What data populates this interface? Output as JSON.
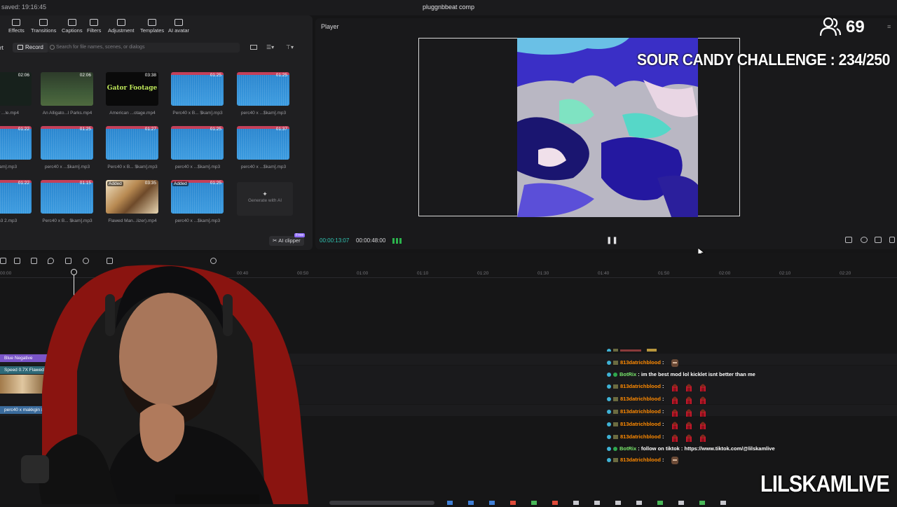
{
  "top_bar": {
    "saved_text": "saved: 19:16:45",
    "project_name": "pluggnbbeat comp"
  },
  "media_panel": {
    "tools": [
      {
        "label": "Effects",
        "icon": "effects-icon"
      },
      {
        "label": "Transitions",
        "icon": "transitions-icon"
      },
      {
        "label": "Captions",
        "icon": "captions-icon"
      },
      {
        "label": "Filters",
        "icon": "filters-icon"
      },
      {
        "label": "Adjustment",
        "icon": "adjustment-icon"
      },
      {
        "label": "Templates",
        "icon": "templates-icon"
      },
      {
        "label": "AI avatar",
        "icon": "ai-avatar-icon"
      }
    ],
    "import_partial": "rt",
    "record_label": "Record",
    "search_placeholder": "Search for file names, scenes, or dialogs",
    "items": [
      {
        "caption": "...ar ...le.mp4",
        "duration": "02:06",
        "kind": "video-dark",
        "added": ""
      },
      {
        "caption": "An Alligato...l Parks.mp4",
        "duration": "02:06",
        "kind": "video-green",
        "added": ""
      },
      {
        "caption": "American ...otage.mp4",
        "duration": "03:38",
        "kind": "gator",
        "added": "",
        "title": "Gator Footage"
      },
      {
        "caption": "Perc40 x B... $kam].mp3",
        "duration": "01:25",
        "kind": "audio",
        "added": ""
      },
      {
        "caption": "perc40 x ...$kam].mp3",
        "duration": "01:25",
        "kind": "audio",
        "added": ""
      },
      {
        "caption": "$kam].mp3",
        "duration": "01:22",
        "kind": "audio",
        "added": ""
      },
      {
        "caption": "perc40 x ...$kam].mp3",
        "duration": "01:25",
        "kind": "audio",
        "added": ""
      },
      {
        "caption": "Perc40 x B... $kam].mp3",
        "duration": "01:27",
        "kind": "audio",
        "added": ""
      },
      {
        "caption": "perc40 x ...$kam].mp3",
        "duration": "01:25",
        "kind": "audio",
        "added": ""
      },
      {
        "caption": "perc40 x ...$kam].mp3",
        "duration": "01:37",
        "kind": "audio",
        "added": ""
      },
      {
        "caption": "mp3 2.mp3",
        "duration": "01:22",
        "kind": "audio",
        "added": ""
      },
      {
        "caption": "Perc40 x B... $kam].mp3",
        "duration": "01:15",
        "kind": "audio",
        "added": ""
      },
      {
        "caption": "Flawed Man...lizer).mp4",
        "duration": "03:35",
        "kind": "video-sepia",
        "added": "Added"
      },
      {
        "caption": "perc40 x ...$kam].mp3",
        "duration": "01:25",
        "kind": "audio",
        "added": "Added"
      }
    ],
    "generate_ai_label": "Generate with AI",
    "ai_clipper_label": "AI clipper",
    "ai_clipper_badge": "Free"
  },
  "player": {
    "title": "Player",
    "current_time": "00:00:13:07",
    "total_time": "00:00:48:00",
    "pause_icon": "pause-icon"
  },
  "timeline": {
    "ruler_ticks": [
      "00:00",
      "",
      "00:40",
      "00:50",
      "01:00",
      "01:10",
      "01:20",
      "01:30",
      "01:40",
      "01:50",
      "02:00",
      "02:10",
      "02:20"
    ],
    "clips": [
      {
        "label": "Blue Negative",
        "color": "#7a55c8"
      },
      {
        "label": "Speed 0.7X   Flawed",
        "color": "#2f6a78"
      },
      {
        "label": "perc40 x makkgin x",
        "color": "#3a6b9c"
      }
    ]
  },
  "overlays": {
    "viewer_count": "69",
    "challenge_text": "SOUR CANDY CHALLENGE : 234/250",
    "watermark": "LILSKAMLIVE"
  },
  "chat": [
    {
      "user": "813datrichblood",
      "text": "",
      "emotes": 1,
      "color": "orange"
    },
    {
      "user": "BotRix",
      "text": "im the best mod lol kicklet isnt better than me",
      "emotes": 0,
      "color": "green"
    },
    {
      "user": "813datrichblood",
      "text": "",
      "emotes": 3,
      "color": "orange"
    },
    {
      "user": "813datrichblood",
      "text": "",
      "emotes": 3,
      "color": "orange"
    },
    {
      "user": "813datrichblood",
      "text": "",
      "emotes": 3,
      "color": "orange"
    },
    {
      "user": "813datrichblood",
      "text": "",
      "emotes": 3,
      "color": "orange"
    },
    {
      "user": "813datrichblood",
      "text": "",
      "emotes": 3,
      "color": "orange"
    },
    {
      "user": "BotRix",
      "text": "follow on tiktok : https://www.tiktok.com/@lilskamlive",
      "emotes": 0,
      "color": "green"
    },
    {
      "user": "813datrichblood",
      "text": "",
      "emotes": 1,
      "color": "orange"
    }
  ],
  "colors": {
    "accent_timecode": "#31c6b4",
    "audio_clip": "#2a86cf",
    "chat_user_orange": "#ff8a00",
    "chat_bot_green": "#78e66b"
  }
}
